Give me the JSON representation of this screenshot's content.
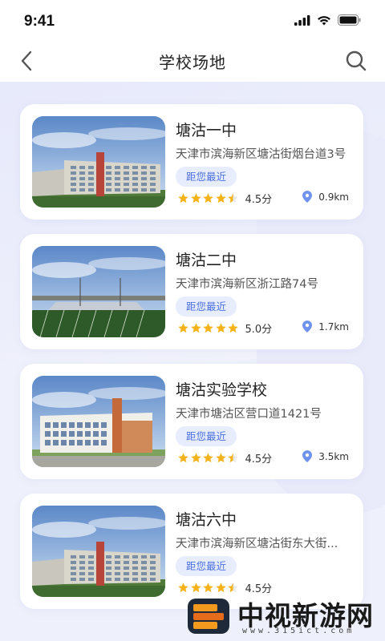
{
  "status": {
    "time": "9:41"
  },
  "nav": {
    "title": "学校场地"
  },
  "colors": {
    "accent": "#4a6fe0",
    "star": "#f5b31b",
    "pin": "#6f92ee"
  },
  "schools": [
    {
      "name": "塘沽一中",
      "address": "天津市滨海新区塘沽街烟台道3号",
      "badge": "距您最近",
      "rating": 4.5,
      "rating_label": "4.5分",
      "distance": "0.9km",
      "image": "school-building"
    },
    {
      "name": "塘沽二中",
      "address": "天津市滨海新区浙江路74号",
      "badge": "距您最近",
      "rating": 5.0,
      "rating_label": "5.0分",
      "distance": "1.7km",
      "image": "sports-field"
    },
    {
      "name": "塘沽实验学校",
      "address": "天津市塘沽区营口道1421号",
      "badge": "距您最近",
      "rating": 4.5,
      "rating_label": "4.5分",
      "distance": "3.5km",
      "image": "modern-school"
    },
    {
      "name": "塘沽六中",
      "address": "天津市滨海新区塘沽街东大街...",
      "badge": "距您最近",
      "rating": 4.5,
      "rating_label": "4.5分",
      "distance": "",
      "image": "school-building"
    }
  ],
  "watermark": {
    "text": "中视新游网",
    "url": "www.315ict.com"
  }
}
